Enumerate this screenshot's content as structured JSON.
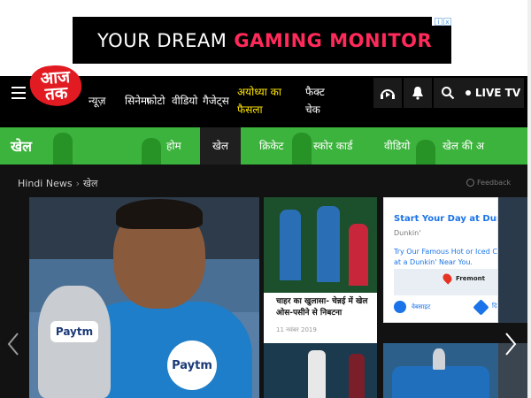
{
  "ad": {
    "text_pre": "YOUR DREAM",
    "text_highlight": "GAMING MONITOR",
    "info_glyph": "i",
    "close_glyph": "x"
  },
  "header": {
    "logo_text": "आज तक",
    "nav": [
      "न्यूज़",
      "सिनेमा",
      "फोटो",
      "वीडियो",
      "गैजेट्स"
    ],
    "highlight_nav": "अयोध्या का फैसला",
    "fact_check": "फैक्ट चेक",
    "live_tv": "LIVE TV",
    "icons": [
      "menu-icon",
      "audio-icon",
      "bell-icon",
      "search-icon"
    ]
  },
  "section": {
    "title": "खेल",
    "tabs": [
      "होम",
      "खेल",
      "क्रिकेट",
      "स्कोर कार्ड",
      "वीडियो",
      "खेल की अ"
    ],
    "active_tab": "खेल",
    "accent_color": "#3cb33c"
  },
  "breadcrumb": {
    "home": "Hindi News",
    "current": "खेल"
  },
  "feedback": "Feedback",
  "cards": {
    "main_paytm_1": "Paytm",
    "main_paytm_2": "Paytm",
    "news_headline": "चाहर का खुलासा- चेन्नई में खेल ओस-पसीने से निबटना",
    "news_date": "11 नवंबर 2019"
  },
  "sponsored": {
    "title": "Start Your Day at Dunkin",
    "advertiser": "Dunkin'",
    "description": "Try Our Famous Hot or Iced C at a Dunkin' Near You.",
    "place": "Fremont",
    "website_label": "वेबसाइट",
    "directions_label": "दि"
  }
}
